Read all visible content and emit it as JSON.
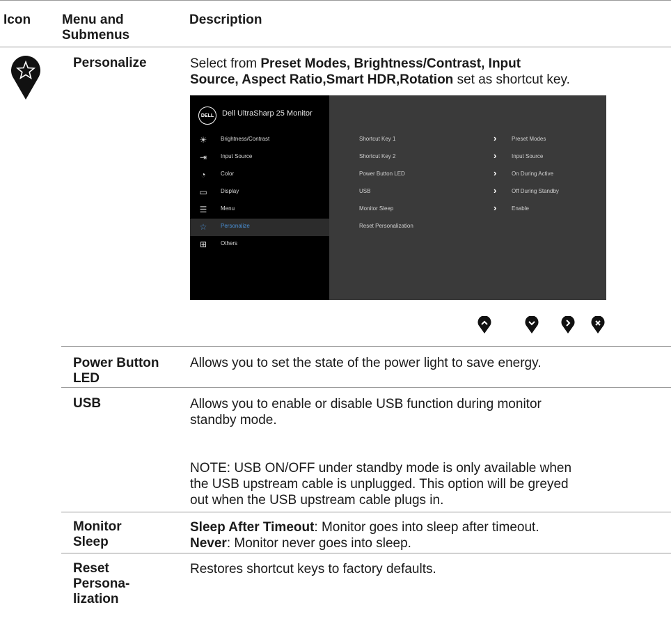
{
  "header": {
    "icon": "Icon",
    "menu_line1": "Menu and",
    "menu_line2": "Submenus",
    "description": "Description"
  },
  "personalize": {
    "name": "Personalize",
    "desc_prefix": "Select from ",
    "desc_bold1": "Preset Modes, Brightness/Contrast, Input",
    "desc_bold2": "Source, Aspect Ratio,Smart HDR,Rotation",
    "desc_suffix": " set as shortcut key."
  },
  "osd": {
    "logo": "DELL",
    "title": "Dell UltraSharp 25 Monitor",
    "menu": [
      {
        "label": "Brightness/Contrast",
        "icon": "brightness-icon"
      },
      {
        "label": "Input Source",
        "icon": "input-source-icon"
      },
      {
        "label": "Color",
        "icon": "color-icon"
      },
      {
        "label": "Display",
        "icon": "display-icon"
      },
      {
        "label": "Menu",
        "icon": "menu-icon"
      },
      {
        "label": "Personalize",
        "icon": "star-icon"
      },
      {
        "label": "Others",
        "icon": "others-icon"
      }
    ],
    "options": [
      {
        "label": "Shortcut Key 1",
        "value": "Preset Modes"
      },
      {
        "label": "Shortcut Key 2",
        "value": "Input Source"
      },
      {
        "label": "Power Button LED",
        "value": "On During Active"
      },
      {
        "label": "USB",
        "value": "Off During Standby"
      },
      {
        "label": "Monitor Sleep",
        "value": "Enable"
      },
      {
        "label": "Reset Personalization",
        "value": ""
      }
    ],
    "active_menu": "Personalize"
  },
  "nav_buttons": [
    "up-button-icon",
    "down-button-icon",
    "right-button-icon",
    "close-button-icon"
  ],
  "rows": {
    "power_led": {
      "name1": "Power Button",
      "name2": "LED",
      "desc": "Allows you to set the state of the power light to save energy."
    },
    "usb": {
      "name": "USB",
      "desc1": "Allows you to enable or disable USB function during monitor",
      "desc2": "standby mode.",
      "note1": "NOTE: USB ON/OFF under standby mode is only available when",
      "note2": "the USB upstream cable is unplugged. This option will be greyed",
      "note3": "out when the USB upstream cable plugs in."
    },
    "monitor_sleep": {
      "name1": "Monitor",
      "name2": "Sleep",
      "l1_bold": "Sleep After Timeout",
      "l1_rest": ": Monitor goes into sleep after timeout.",
      "l2_bold": "Never",
      "l2_rest": ": Monitor never goes into sleep."
    },
    "reset": {
      "name1": "Reset",
      "name2": "Persona-",
      "name3": "lization",
      "desc": "Restores shortcut keys to factory defaults."
    }
  },
  "colors": {
    "osd_background": "#3a3a3a",
    "osd_menu": "#000000",
    "active": "#4a8fd4"
  }
}
